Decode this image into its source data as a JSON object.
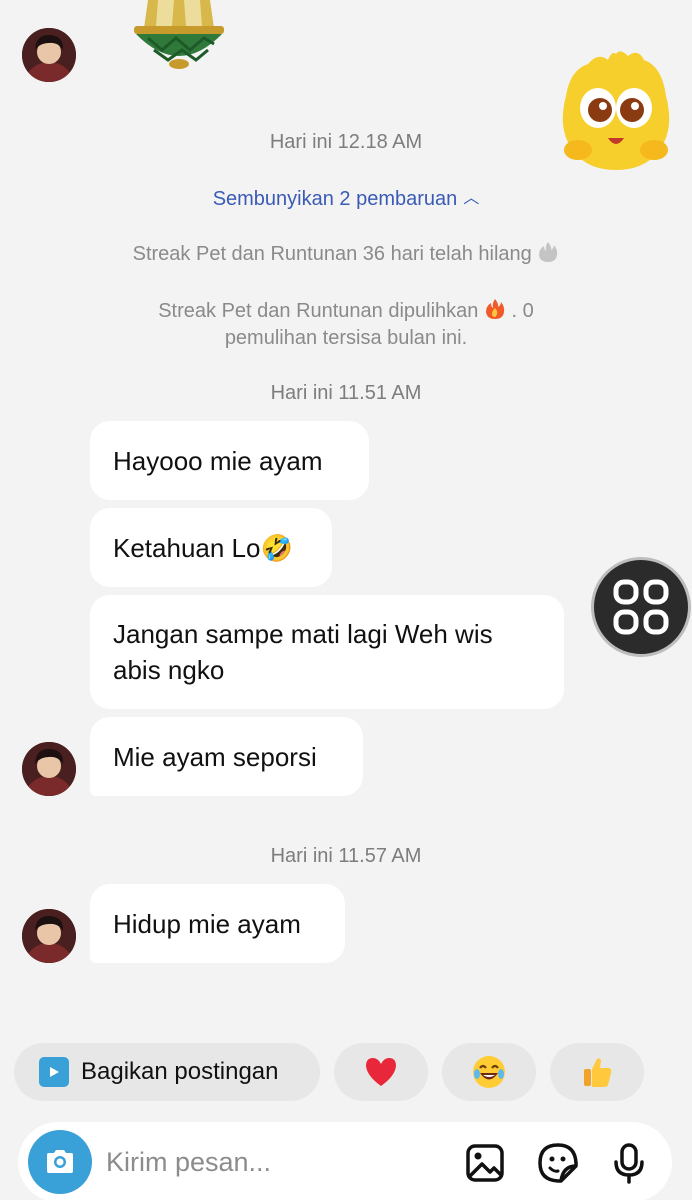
{
  "header": {
    "first_timestamp": "Hari ini 12.18 AM",
    "hide_updates_link": "Sembunyikan 2 pembaruan",
    "system_messages": [
      {
        "text": "Streak Pet dan Runtunan 36 hari telah hilang"
      },
      {
        "text_line1": "Streak Pet dan Runtunan dipulihkan",
        "text_line1_after": " . 0",
        "text_line2": "pemulihan tersisa bulan ini."
      }
    ]
  },
  "conversation": [
    {
      "timestamp": "Hari ini 11.51 AM",
      "messages": [
        {
          "text": "Hayooo mie ayam"
        },
        {
          "text": "Ketahuan Lo🤣"
        },
        {
          "line1": "Jangan sampe mati lagi Weh wis",
          "line2": "abis ngko"
        },
        {
          "text": "Mie ayam seporsi"
        }
      ]
    },
    {
      "timestamp": "Hari ini 11.57 AM",
      "messages": [
        {
          "text": "Hidup mie ayam"
        }
      ]
    }
  ],
  "quick_replies": {
    "share_label": "Bagikan postingan",
    "reactions": [
      "❤️",
      "😂",
      "👍"
    ]
  },
  "composer": {
    "placeholder": "Kirim pesan..."
  },
  "icons": {
    "camera": "camera-icon",
    "gallery": "image-gallery-icon",
    "sticker": "sticker-icon",
    "microphone": "microphone-icon",
    "share": "play-square-icon",
    "floating": "grid-apps-icon"
  },
  "colors": {
    "background": "#f3f3f3",
    "bubble": "#ffffff",
    "link": "#3a5bb5",
    "camera_button": "#3aa0d8",
    "timestamp": "#7d7d7d"
  }
}
